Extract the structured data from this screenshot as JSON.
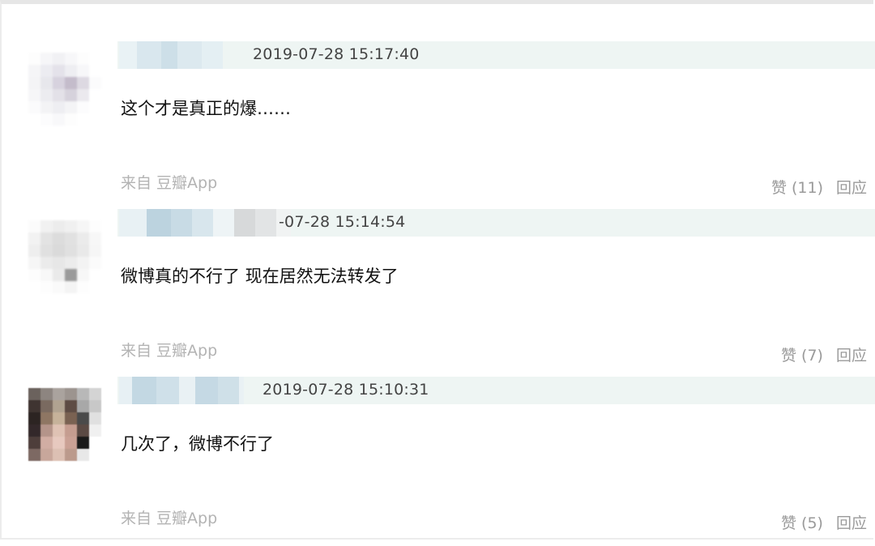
{
  "comments": [
    {
      "timestamp": "2019-07-28 15:17:40",
      "text": "这个才是真正的爆……",
      "source": "来自 豆瓣App",
      "like_label": "赞 (11)",
      "reply_label": "回应"
    },
    {
      "timestamp": "-07-28 15:14:54",
      "text": "微博真的不行了 现在居然无法转发了",
      "source": "来自 豆瓣App",
      "like_label": "赞 (7)",
      "reply_label": "回应"
    },
    {
      "timestamp": "2019-07-28 15:10:31",
      "text": "几次了，微博不行了",
      "source": "来自 豆瓣App",
      "like_label": "赞 (5)",
      "reply_label": "回应"
    }
  ]
}
